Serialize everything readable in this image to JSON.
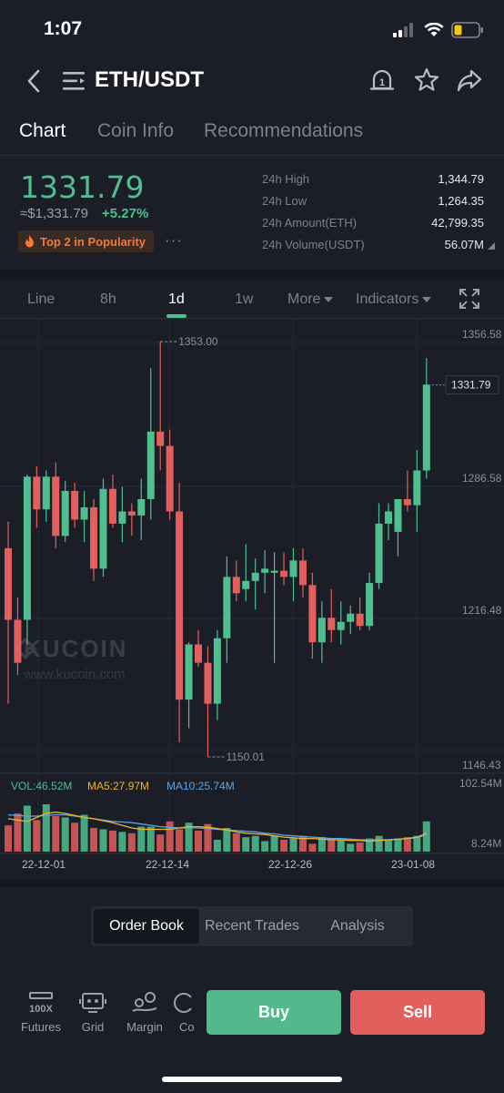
{
  "status": {
    "time": "1:07"
  },
  "nav": {
    "title": "ETH/USDT"
  },
  "tabs": [
    "Chart",
    "Coin Info",
    "Recommendations"
  ],
  "price": {
    "last": "1331.79",
    "fiat": "≈$1,331.79",
    "change": "+5.27%",
    "popularity": "Top 2 in Popularity"
  },
  "stats": [
    {
      "label": "24h High",
      "value": "1,344.79"
    },
    {
      "label": "24h Low",
      "value": "1,264.35"
    },
    {
      "label": "24h Amount(ETH)",
      "value": "42,799.35"
    },
    {
      "label": "24h Volume(USDT)",
      "value": "56.07M"
    }
  ],
  "intervals": [
    "Line",
    "8h",
    "1d",
    "1w",
    "More",
    "Indicators"
  ],
  "colors": {
    "up": "#4fbf8f",
    "down": "#e35f5d",
    "ma5": "#f0b429",
    "ma10": "#5aa5e6"
  },
  "chart_data": {
    "type": "candlestick",
    "price_axis": [
      "1356.58",
      "1331.79",
      "1286.58",
      "1216.48",
      "1146.43"
    ],
    "ylim": [
      1146.43,
      1356.58
    ],
    "high_label": "1353.00",
    "low_label": "1150.01",
    "last_label": "1331.79",
    "watermark": "KUCOIN",
    "watermark_url": "www.kucoin.com",
    "candles": [
      {
        "o": 1252,
        "h": 1265,
        "l": 1176,
        "c": 1217
      },
      {
        "o": 1217,
        "h": 1228,
        "l": 1190,
        "c": 1196
      },
      {
        "o": 1217,
        "h": 1288,
        "l": 1205,
        "c": 1287
      },
      {
        "o": 1287,
        "h": 1292,
        "l": 1262,
        "c": 1271
      },
      {
        "o": 1271,
        "h": 1290,
        "l": 1265,
        "c": 1287
      },
      {
        "o": 1287,
        "h": 1294,
        "l": 1252,
        "c": 1258
      },
      {
        "o": 1258,
        "h": 1285,
        "l": 1255,
        "c": 1280
      },
      {
        "o": 1280,
        "h": 1284,
        "l": 1262,
        "c": 1266
      },
      {
        "o": 1266,
        "h": 1280,
        "l": 1255,
        "c": 1272
      },
      {
        "o": 1272,
        "h": 1276,
        "l": 1236,
        "c": 1242
      },
      {
        "o": 1242,
        "h": 1286,
        "l": 1238,
        "c": 1281
      },
      {
        "o": 1281,
        "h": 1288,
        "l": 1262,
        "c": 1264
      },
      {
        "o": 1264,
        "h": 1282,
        "l": 1255,
        "c": 1270
      },
      {
        "o": 1270,
        "h": 1274,
        "l": 1258,
        "c": 1268
      },
      {
        "o": 1268,
        "h": 1286,
        "l": 1256,
        "c": 1276
      },
      {
        "o": 1276,
        "h": 1340,
        "l": 1266,
        "c": 1309
      },
      {
        "o": 1309,
        "h": 1353,
        "l": 1290,
        "c": 1302
      },
      {
        "o": 1302,
        "h": 1310,
        "l": 1266,
        "c": 1270
      },
      {
        "o": 1270,
        "h": 1284,
        "l": 1157,
        "c": 1178
      },
      {
        "o": 1178,
        "h": 1206,
        "l": 1164,
        "c": 1205
      },
      {
        "o": 1205,
        "h": 1212,
        "l": 1194,
        "c": 1196
      },
      {
        "o": 1196,
        "h": 1204,
        "l": 1150,
        "c": 1176
      },
      {
        "o": 1176,
        "h": 1212,
        "l": 1168,
        "c": 1208
      },
      {
        "o": 1208,
        "h": 1248,
        "l": 1196,
        "c": 1238
      },
      {
        "o": 1238,
        "h": 1246,
        "l": 1226,
        "c": 1230
      },
      {
        "o": 1232,
        "h": 1254,
        "l": 1226,
        "c": 1236
      },
      {
        "o": 1236,
        "h": 1247,
        "l": 1222,
        "c": 1240
      },
      {
        "o": 1240,
        "h": 1251,
        "l": 1230,
        "c": 1242
      },
      {
        "o": 1240,
        "h": 1250,
        "l": 1196,
        "c": 1241
      },
      {
        "o": 1241,
        "h": 1250,
        "l": 1234,
        "c": 1238
      },
      {
        "o": 1238,
        "h": 1252,
        "l": 1226,
        "c": 1246
      },
      {
        "o": 1246,
        "h": 1252,
        "l": 1228,
        "c": 1234
      },
      {
        "o": 1234,
        "h": 1240,
        "l": 1198,
        "c": 1206
      },
      {
        "o": 1206,
        "h": 1226,
        "l": 1196,
        "c": 1218
      },
      {
        "o": 1218,
        "h": 1232,
        "l": 1206,
        "c": 1212
      },
      {
        "o": 1212,
        "h": 1226,
        "l": 1205,
        "c": 1216
      },
      {
        "o": 1216,
        "h": 1224,
        "l": 1210,
        "c": 1220
      },
      {
        "o": 1220,
        "h": 1228,
        "l": 1212,
        "c": 1214
      },
      {
        "o": 1214,
        "h": 1240,
        "l": 1212,
        "c": 1235
      },
      {
        "o": 1235,
        "h": 1274,
        "l": 1232,
        "c": 1264
      },
      {
        "o": 1264,
        "h": 1274,
        "l": 1256,
        "c": 1270
      },
      {
        "o": 1260,
        "h": 1276,
        "l": 1248,
        "c": 1276
      },
      {
        "o": 1276,
        "h": 1290,
        "l": 1270,
        "c": 1273
      },
      {
        "o": 1273,
        "h": 1300,
        "l": 1260,
        "c": 1290
      },
      {
        "o": 1290,
        "h": 1345,
        "l": 1286,
        "c": 1332
      }
    ],
    "volume": {
      "vol_label": "VOL:46.52M",
      "ma5_label": "MA5:27.97M",
      "ma10_label": "MA10:25.74M",
      "max_label": "102.54M",
      "min_label": "8.24M",
      "ylim": [
        0,
        102.54
      ],
      "values": [
        40,
        58,
        70,
        48,
        72,
        54,
        52,
        44,
        56,
        36,
        34,
        32,
        30,
        28,
        38,
        38,
        26,
        46,
        34,
        44,
        32,
        42,
        18,
        36,
        28,
        22,
        24,
        16,
        24,
        18,
        20,
        24,
        12,
        22,
        20,
        18,
        12,
        14,
        20,
        24,
        18,
        20,
        22,
        24,
        46
      ],
      "ma5": [
        50,
        48,
        46,
        52,
        58,
        60,
        58,
        55,
        52,
        50,
        47,
        44,
        40,
        36,
        34,
        34,
        34,
        34,
        36,
        38,
        38,
        37,
        35,
        33,
        30,
        28,
        27,
        26,
        24,
        22,
        21,
        20,
        20,
        19,
        18,
        18,
        17,
        17,
        16,
        17,
        18,
        19,
        20,
        22,
        28
      ],
      "ma10": [
        56,
        55,
        54,
        54,
        55,
        56,
        56,
        54,
        52,
        50,
        48,
        46,
        45,
        44,
        42,
        40,
        38,
        37,
        36,
        36,
        36,
        35,
        34,
        33,
        32,
        31,
        30,
        28,
        27,
        25,
        24,
        23,
        22,
        21,
        20,
        20,
        19,
        18,
        18,
        18,
        18,
        19,
        20,
        21,
        26
      ]
    },
    "x_ticks": [
      "22-12-01",
      "22-12-14",
      "22-12-26",
      "23-01-08"
    ]
  },
  "bottom": {
    "segments": [
      "Order Book",
      "Recent Trades",
      "Analysis"
    ],
    "tools": [
      "Futures",
      "Grid",
      "Margin",
      "Co"
    ],
    "badge_100x": "100X",
    "buy": "Buy",
    "sell": "Sell"
  }
}
